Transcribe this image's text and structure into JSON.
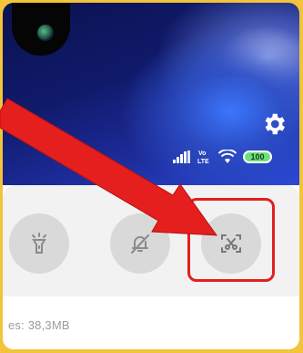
{
  "status": {
    "volte_label": "Vo\nLTE",
    "battery_level": "100"
  },
  "quick_settings": {
    "tiles": [
      {
        "name": "flashlight",
        "icon": "flashlight-icon"
      },
      {
        "name": "silent",
        "icon": "bell-off-icon"
      },
      {
        "name": "screenshot",
        "icon": "screenshot-icon"
      }
    ]
  },
  "storage": {
    "text": "es: 38,3MB"
  },
  "colors": {
    "highlight": "#e51e1e",
    "arrow": "#e51e1e",
    "battery": "#6ee07a",
    "tile_bg": "#d9d9d9",
    "frame_border": "#f3c33a"
  }
}
